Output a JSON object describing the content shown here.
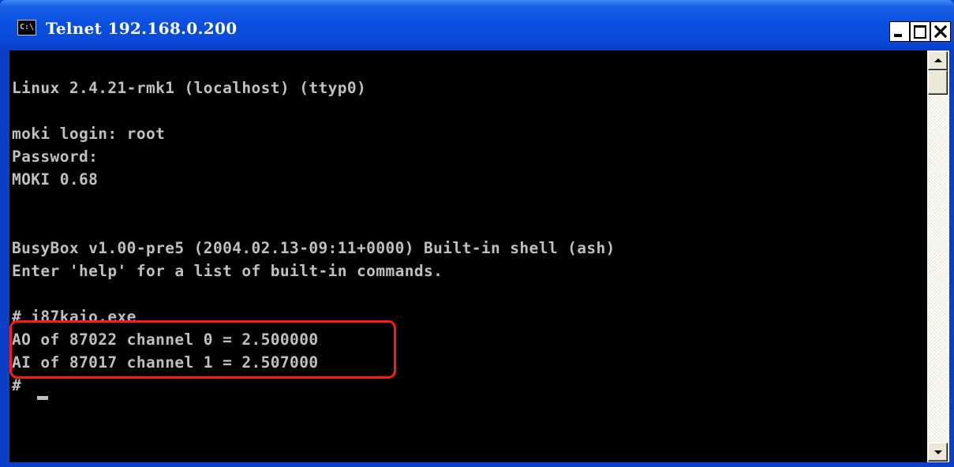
{
  "window": {
    "title": "Telnet 192.168.0.200",
    "icon": "console-icon",
    "icon_text": "C:\\"
  },
  "titlebar_buttons": {
    "minimize": "minimize-icon",
    "maximize": "maximize-icon",
    "close": "close-icon"
  },
  "console": {
    "lines": [
      "Linux 2.4.21-rmk1 (localhost) (ttyp0)",
      "moki login: root",
      "Password:",
      "MOKI 0.68",
      "BusyBox v1.00-pre5 (2004.02.13-09:11+0000) Built-in shell (ash)",
      "Enter 'help' for a list of built-in commands.",
      "# i87kaio.exe",
      "AO of 87022 channel 0 = 2.500000",
      "AI of 87017 channel 1 = 2.507000",
      "#"
    ]
  },
  "annotation": {
    "color": "#ff1a1a"
  },
  "colors": {
    "titlebar": "#0a4fe0",
    "console_bg": "#000000",
    "console_text": "#c0c0c0"
  }
}
